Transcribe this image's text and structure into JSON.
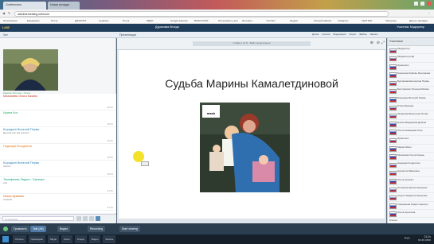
{
  "browser": {
    "tabs": [
      {
        "label": "Conferences",
        "active": true
      },
      {
        "label": "Новая вкладка",
        "active": false
      }
    ],
    "url": "allonlinemeeting.net/room",
    "bookmarks": [
      "Приложения",
      "Ежедневно",
      "Почта",
      "ДИАЛОГИ",
      "Сервисы",
      "Почта",
      "ИДЕИ",
      "Google adsense",
      "ВКОНТАКТЕ",
      "Инструменты для",
      "Интернет",
      "YouTube",
      "Яндекс",
      "Личный кабинет",
      "Instagram",
      "ТЕСТИНГ",
      "Обучение",
      "Другие закладки"
    ]
  },
  "app": {
    "logo": "LIVE",
    "userpanel": "Дуриковая беседа",
    "status": "Участник: Модератор",
    "toolbar": {
      "left": "Чат",
      "center": "Презентация",
      "right_items": [
        "Доска",
        "Сессия",
        "Модерация",
        "Опрос",
        "Файлы",
        "Запись"
      ]
    }
  },
  "video": {
    "caption": "Камера: Ддучна + Ольга"
  },
  "chat": {
    "messages": [
      {
        "name": "Махмоева Ольга Казань",
        "name_color": "#c0392b",
        "text": "",
        "time": "20:3x"
      },
      {
        "name": "Ирина Кох",
        "name_color": "#27ae60",
        "text": "",
        "time": "20:3x"
      },
      {
        "name": "Бородкин Виталий Пермь",
        "name_color": "#2980b9",
        "text": "Да ещё все как хорошо",
        "time": "20:3x"
      },
      {
        "name": "Надежда Кондратюк",
        "name_color": "#e67e22",
        "text": "",
        "time": "20:3x"
      },
      {
        "name": "Бородкин Виталий Пермь",
        "name_color": "#2980b9",
        "text": "пошло",
        "time": "20:3x"
      },
      {
        "name": "Тимофеева Лидия г. Сарапул",
        "name_color": "#16a085",
        "text": "или",
        "time": "21:0x"
      },
      {
        "name": "Ольга Кузьмич",
        "name_color": "#d35400",
        "text": "спасибо",
        "time": "21:0x"
      }
    ],
    "input_placeholder": "Сообщение"
  },
  "slide": {
    "title": "Судьба Марины Камалетдиновой",
    "photo_label": "mash",
    "header_bar_text": "Слайд 1 из N · Файл презентации"
  },
  "participants": {
    "header": "Участники",
    "items": [
      "Модератор",
      "Модератор НД",
      "Ирина Кох",
      "Борисова Любовь Монтажник",
      "Бурлакова Екатерина Пермь",
      "Быстрякова Татьяна Москва",
      "Бородкин Виталий Пермь",
      "Елена Бежеда",
      "Захарова Валентина Поляк",
      "Елена Мирданова Дубков",
      "Ольга Казанцева Улан",
      "Ирина Кох",
      "Мария Шило",
      "Махмоева Ольга Казань",
      "Надежда Кондратюк",
      "Нурзалия Ивановна",
      "Ольга Кузьмич",
      "Полякова Ирина Кемерово",
      "Серых Людмила Кемерово",
      "Тимофеева Лидия Сарапул",
      "Ольга Кульпина"
    ],
    "footer": "Бланки"
  },
  "controls": {
    "talk": "Talk (Alt)",
    "video_toggle": "Видео",
    "recording": "Recording",
    "start_sharing": "Start sharing",
    "volume": "Громкость"
  },
  "taskbar": {
    "apps": [
      "Chrome",
      "Проводник",
      "Skype",
      "Zoom",
      "Опера",
      "Видео",
      "Запись"
    ],
    "lang": "РУС",
    "time": "21:2x",
    "date": "xx.xx.xxxx"
  },
  "colors": {
    "header": "#1f3d5a",
    "accent": "#ffd24a",
    "cursor_highlight": "#f3e12a"
  }
}
